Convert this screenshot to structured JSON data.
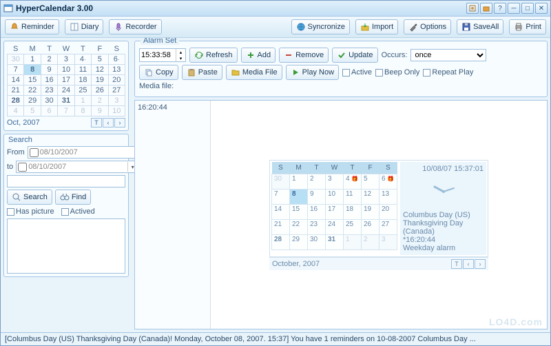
{
  "title": "HyperCalendar 3.00",
  "toolbar_left": {
    "reminder": "Reminder",
    "diary": "Diary",
    "recorder": "Recorder"
  },
  "toolbar_right": {
    "sync": "Syncronize",
    "import": "Import",
    "options": "Options",
    "saveall": "SaveAll",
    "print": "Print"
  },
  "minical": {
    "dow": [
      "S",
      "M",
      "T",
      "W",
      "T",
      "F",
      "S"
    ],
    "month": "Oct, 2007",
    "rows": [
      [
        {
          "d": "30",
          "o": true
        },
        {
          "d": "1"
        },
        {
          "d": "2"
        },
        {
          "d": "3"
        },
        {
          "d": "4",
          "dot": true
        },
        {
          "d": "5"
        },
        {
          "d": "6",
          "dot": true
        }
      ],
      [
        {
          "d": "7"
        },
        {
          "d": "8",
          "today": true,
          "b": true
        },
        {
          "d": "9"
        },
        {
          "d": "10"
        },
        {
          "d": "11"
        },
        {
          "d": "12"
        },
        {
          "d": "13"
        }
      ],
      [
        {
          "d": "14"
        },
        {
          "d": "15"
        },
        {
          "d": "16"
        },
        {
          "d": "17"
        },
        {
          "d": "18"
        },
        {
          "d": "19"
        },
        {
          "d": "20"
        }
      ],
      [
        {
          "d": "21"
        },
        {
          "d": "22"
        },
        {
          "d": "23"
        },
        {
          "d": "24"
        },
        {
          "d": "25"
        },
        {
          "d": "26"
        },
        {
          "d": "27"
        }
      ],
      [
        {
          "d": "28",
          "b": true
        },
        {
          "d": "29"
        },
        {
          "d": "30"
        },
        {
          "d": "31",
          "b": true
        },
        {
          "d": "1",
          "o": true
        },
        {
          "d": "2",
          "o": true
        },
        {
          "d": "3",
          "o": true
        }
      ],
      [
        {
          "d": "4",
          "o": true
        },
        {
          "d": "5",
          "o": true
        },
        {
          "d": "6",
          "o": true
        },
        {
          "d": "7",
          "o": true
        },
        {
          "d": "8",
          "o": true
        },
        {
          "d": "9",
          "o": true
        },
        {
          "d": "10",
          "o": true
        }
      ]
    ],
    "btn_t": "T"
  },
  "search": {
    "title": "Search",
    "from_label": "From",
    "to_label": "to",
    "from_val": "08/10/2007",
    "to_val": "08/10/2007",
    "search_btn": "Search",
    "find_btn": "Find",
    "has_picture": "Has picture",
    "actived": "Actived"
  },
  "alarmset": {
    "title": "Alarm Set",
    "time": "15:33:58",
    "refresh": "Refresh",
    "add": "Add",
    "remove": "Remove",
    "update": "Update",
    "occurs_label": "Occurs:",
    "occurs_val": "once",
    "copy": "Copy",
    "paste": "Paste",
    "mediafile_btn": "Media File",
    "playnow": "Play Now",
    "active": "Active",
    "beeponly": "Beep Only",
    "repeatplay": "Repeat Play",
    "mediafile_label": "Media file:"
  },
  "medialist": {
    "item0": "16:20:44"
  },
  "bigcal": {
    "dow": [
      "S",
      "M",
      "T",
      "W",
      "T",
      "F",
      "S"
    ],
    "timestamp": "10/08/07 15:37:01",
    "rows": [
      [
        {
          "d": "30",
          "o": true
        },
        {
          "d": "1"
        },
        {
          "d": "2"
        },
        {
          "d": "3"
        },
        {
          "d": "4",
          "icon": true
        },
        {
          "d": "5"
        },
        {
          "d": "6",
          "icon": true
        }
      ],
      [
        {
          "d": "7"
        },
        {
          "d": "8",
          "today": true,
          "b": true
        },
        {
          "d": "9"
        },
        {
          "d": "10"
        },
        {
          "d": "11"
        },
        {
          "d": "12"
        },
        {
          "d": "13"
        }
      ],
      [
        {
          "d": "14"
        },
        {
          "d": "15"
        },
        {
          "d": "16"
        },
        {
          "d": "17"
        },
        {
          "d": "18"
        },
        {
          "d": "19"
        },
        {
          "d": "20"
        }
      ],
      [
        {
          "d": "21"
        },
        {
          "d": "22"
        },
        {
          "d": "23"
        },
        {
          "d": "24"
        },
        {
          "d": "25"
        },
        {
          "d": "26"
        },
        {
          "d": "27"
        }
      ],
      [
        {
          "d": "28",
          "b": true
        },
        {
          "d": "29"
        },
        {
          "d": "30"
        },
        {
          "d": "31",
          "b": true
        },
        {
          "d": "1",
          "o": true
        },
        {
          "d": "2",
          "o": true
        },
        {
          "d": "3",
          "o": true
        }
      ]
    ],
    "month": "October, 2007",
    "btn_t": "T",
    "info1": "Columbus Day (US)",
    "info2": "Thanksgiving Day (Canada)",
    "info3": "*16:20:44",
    "info4": "Weekday alarm"
  },
  "statusbar": "[Columbus Day (US) Thanksgiving Day (Canada)! Monday, October 08, 2007. 15:37] You have 1 reminders on 10-08-2007 Columbus Day ...",
  "watermark": "LO4D.com"
}
